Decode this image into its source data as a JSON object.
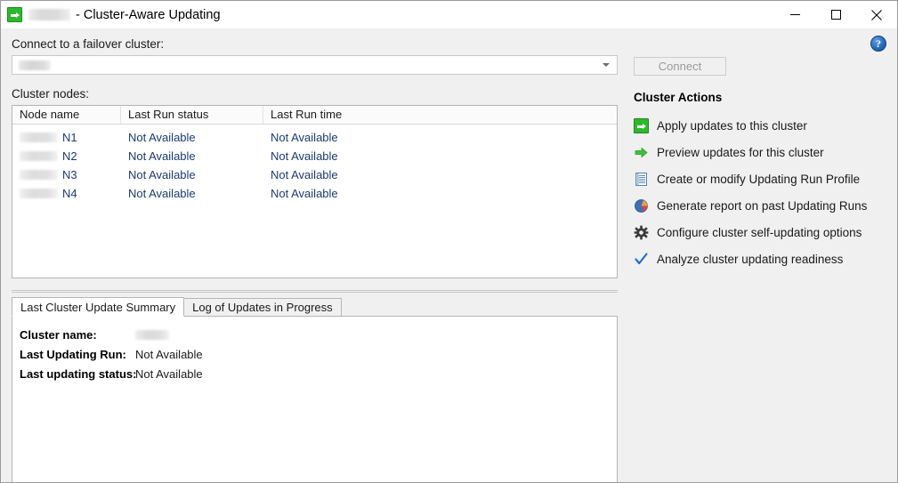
{
  "window": {
    "title_suffix": "- Cluster-Aware Updating",
    "app_icon": "apply-updates-icon",
    "redacted_cluster_name": "",
    "buttons": {
      "minimize": "minimize-button",
      "maximize": "maximize-button",
      "close": "close-button"
    }
  },
  "connect": {
    "label": "Connect to a failover cluster:",
    "combo_value": "",
    "combo_placeholder": "",
    "button_label": "Connect",
    "button_enabled": false
  },
  "nodes": {
    "label": "Cluster nodes:",
    "columns": [
      "Node name",
      "Last Run status",
      "Last Run time"
    ],
    "rows": [
      {
        "name": "N1",
        "status": "Not Available",
        "time": "Not Available"
      },
      {
        "name": "N2",
        "status": "Not Available",
        "time": "Not Available"
      },
      {
        "name": "N3",
        "status": "Not Available",
        "time": "Not Available"
      },
      {
        "name": "N4",
        "status": "Not Available",
        "time": "Not Available"
      }
    ]
  },
  "tabs": {
    "items": [
      {
        "label": "Last Cluster Update Summary",
        "active": true
      },
      {
        "label": "Log of Updates in Progress",
        "active": false
      }
    ]
  },
  "summary": {
    "fields": [
      {
        "label": "Cluster name:",
        "value": ""
      },
      {
        "label": "Last Updating Run:",
        "value": "Not Available"
      },
      {
        "label": "Last updating status:",
        "value": "Not Available"
      }
    ]
  },
  "actions": {
    "title": "Cluster Actions",
    "items": [
      {
        "label": "Apply updates to this cluster",
        "icon": "apply-updates-icon"
      },
      {
        "label": "Preview updates for this cluster",
        "icon": "preview-arrow-icon"
      },
      {
        "label": "Create or modify Updating Run Profile",
        "icon": "notepad-icon"
      },
      {
        "label": "Generate report on past Updating Runs",
        "icon": "pie-chart-report-icon"
      },
      {
        "label": "Configure cluster self-updating options",
        "icon": "gear-icon"
      },
      {
        "label": "Analyze cluster updating readiness",
        "icon": "check-mark-icon"
      }
    ]
  },
  "help": {
    "glyph": "?",
    "name": "help-icon"
  },
  "colors": {
    "accent_green": "#2db82d",
    "link_blue": "#1a3a74",
    "help_blue": "#1f5fae",
    "window_bg": "#f0f0f0"
  }
}
